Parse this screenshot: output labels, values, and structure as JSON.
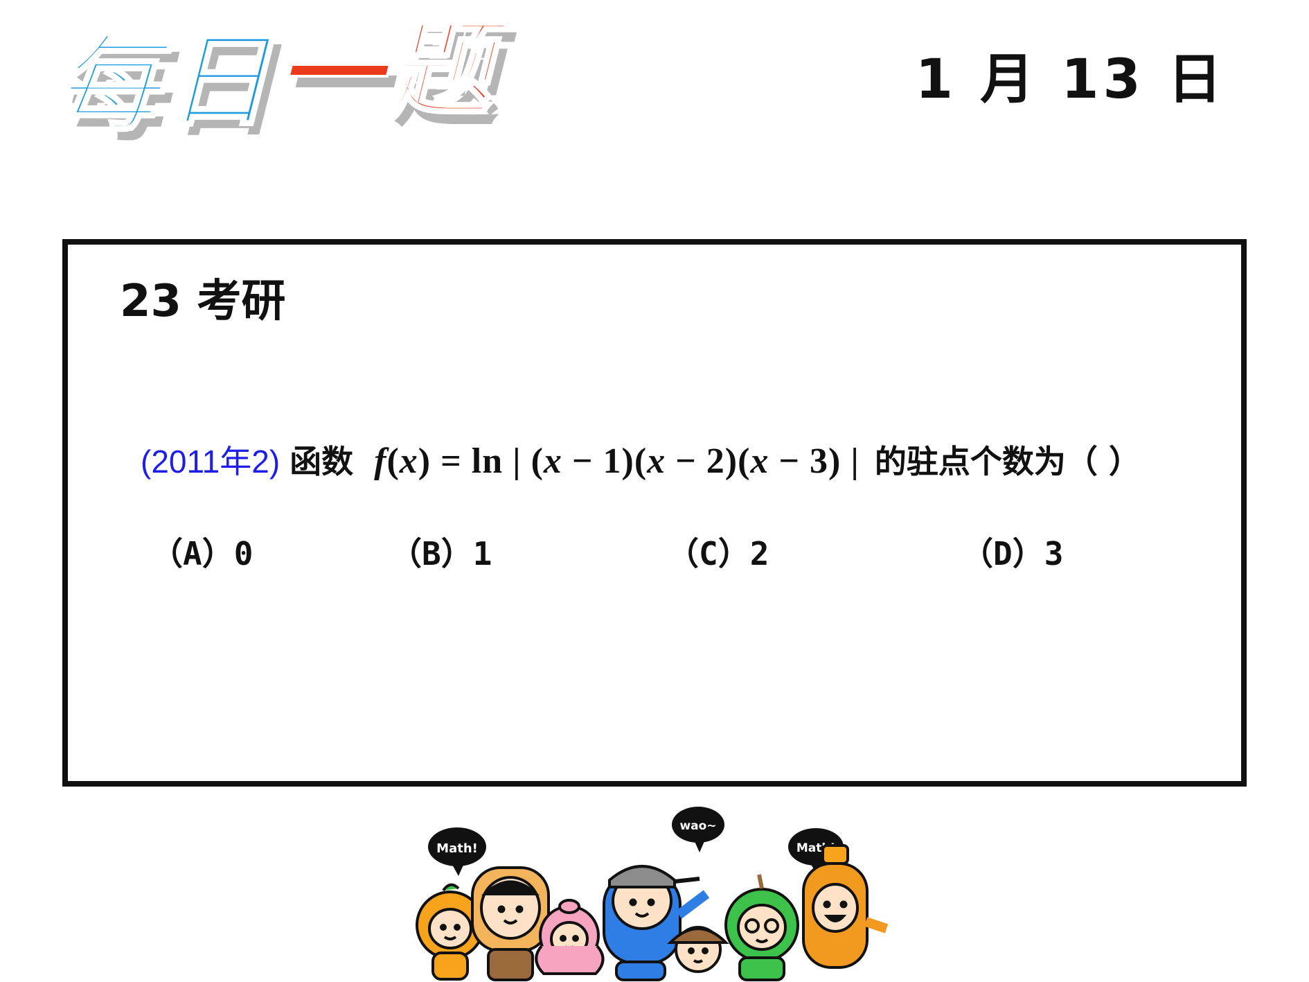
{
  "header": {
    "logo_chars": [
      "每",
      "日",
      "一",
      "题"
    ],
    "date": "1 月 13 日"
  },
  "question": {
    "exam_tag": "23 考研",
    "source": "(2011年2)",
    "lead": "函数",
    "formula": {
      "f": "f",
      "open": "(",
      "x": "x",
      "rest1": ") = ln | (",
      "x1": "x",
      "rest2": " − 1)(",
      "x2": "x",
      "rest3": " − 2)(",
      "x3": "x",
      "rest4": " − 3) |"
    },
    "tail": "的驻点个数为（ ）",
    "options": [
      {
        "label": "（A）0"
      },
      {
        "label": "（B）1"
      },
      {
        "label": "（C）2"
      },
      {
        "label": "（D）3"
      }
    ]
  },
  "mascots": {
    "bubbles": [
      "Math!",
      "wao~",
      "Math!"
    ],
    "colors": {
      "orange": "#f7a31b",
      "bread": "#f3b45c",
      "pink": "#f6a4c0",
      "blue": "#2f7ee6",
      "green": "#3cc14a",
      "amber": "#f29a1f",
      "brown": "#9b6a3c"
    }
  }
}
